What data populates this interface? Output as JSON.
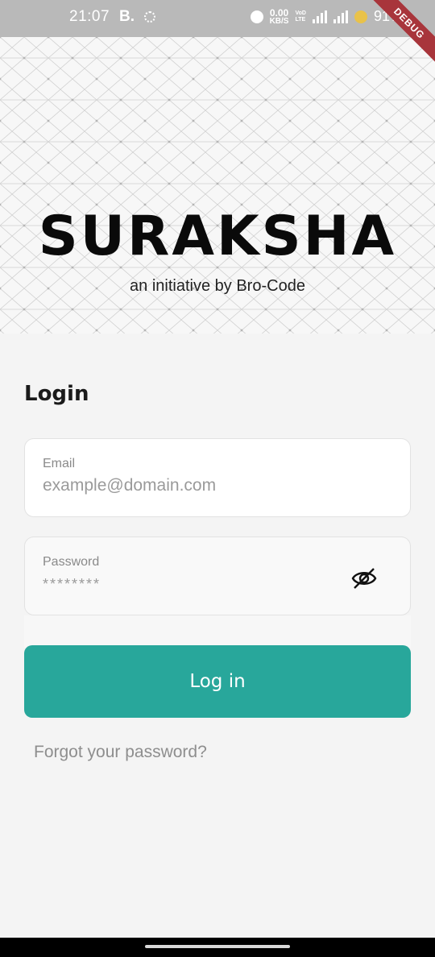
{
  "status_bar": {
    "time": "21:07",
    "carrier_badge": "B.",
    "net_speed_value": "0.00",
    "net_speed_unit": "KB/S",
    "volte_top": "VoD",
    "volte_bottom": "LTE",
    "network_type": "4G",
    "battery": "91%",
    "icons": [
      "alarm-icon",
      "signal-icon",
      "signal-icon",
      "battery-saver-icon"
    ]
  },
  "debug_banner": "DEBUG",
  "hero": {
    "title": "SURAKSHA",
    "subtitle": "an initiative by Bro-Code"
  },
  "login": {
    "heading": "Login",
    "email": {
      "label": "Email",
      "placeholder": "example@domain.com",
      "value": ""
    },
    "password": {
      "label": "Password",
      "placeholder": "********",
      "value": "",
      "toggle_icon": "eye-off-icon"
    },
    "submit_label": "Log in",
    "forgot_label": "Forgot your password?"
  },
  "colors": {
    "accent": "#28a79b",
    "background": "#f4f4f4",
    "status_bar": "#b9b9b9",
    "debug_ribbon": "#a8353b"
  }
}
